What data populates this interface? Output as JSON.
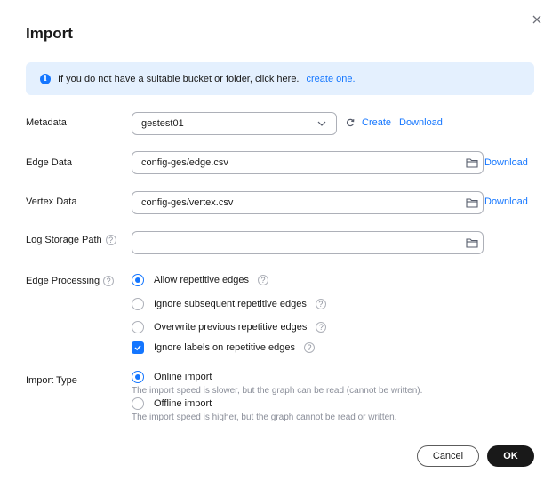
{
  "dialog": {
    "title": "Import"
  },
  "banner": {
    "text": "If you do not have a suitable bucket or folder, click here.",
    "link": "create one."
  },
  "metadata": {
    "label": "Metadata",
    "value": "gestest01",
    "create_label": "Create",
    "download_label": "Download"
  },
  "edge_data": {
    "label": "Edge Data",
    "value": "config-ges/edge.csv",
    "download_label": "Download"
  },
  "vertex_data": {
    "label": "Vertex Data",
    "value": "config-ges/vertex.csv",
    "download_label": "Download"
  },
  "log_storage": {
    "label": "Log Storage Path",
    "value": ""
  },
  "edge_processing": {
    "label": "Edge Processing",
    "options": [
      {
        "label": "Allow repetitive edges",
        "selected": true
      },
      {
        "label": "Ignore subsequent repetitive edges",
        "selected": false
      },
      {
        "label": "Overwrite previous repetitive edges",
        "selected": false
      }
    ],
    "checkbox": {
      "label": "Ignore labels on repetitive edges",
      "checked": true
    }
  },
  "import_type": {
    "label": "Import Type",
    "options": [
      {
        "label": "Online import",
        "desc": "The import speed is slower, but the graph can be read (cannot be written).",
        "selected": true
      },
      {
        "label": "Offline import",
        "desc": "The import speed is higher, but the graph cannot be read or written.",
        "selected": false
      }
    ]
  },
  "footer": {
    "cancel_label": "Cancel",
    "ok_label": "OK"
  },
  "colors": {
    "accent": "#1476ff",
    "banner_bg": "#e4f0fe",
    "primary_button": "#191919"
  }
}
